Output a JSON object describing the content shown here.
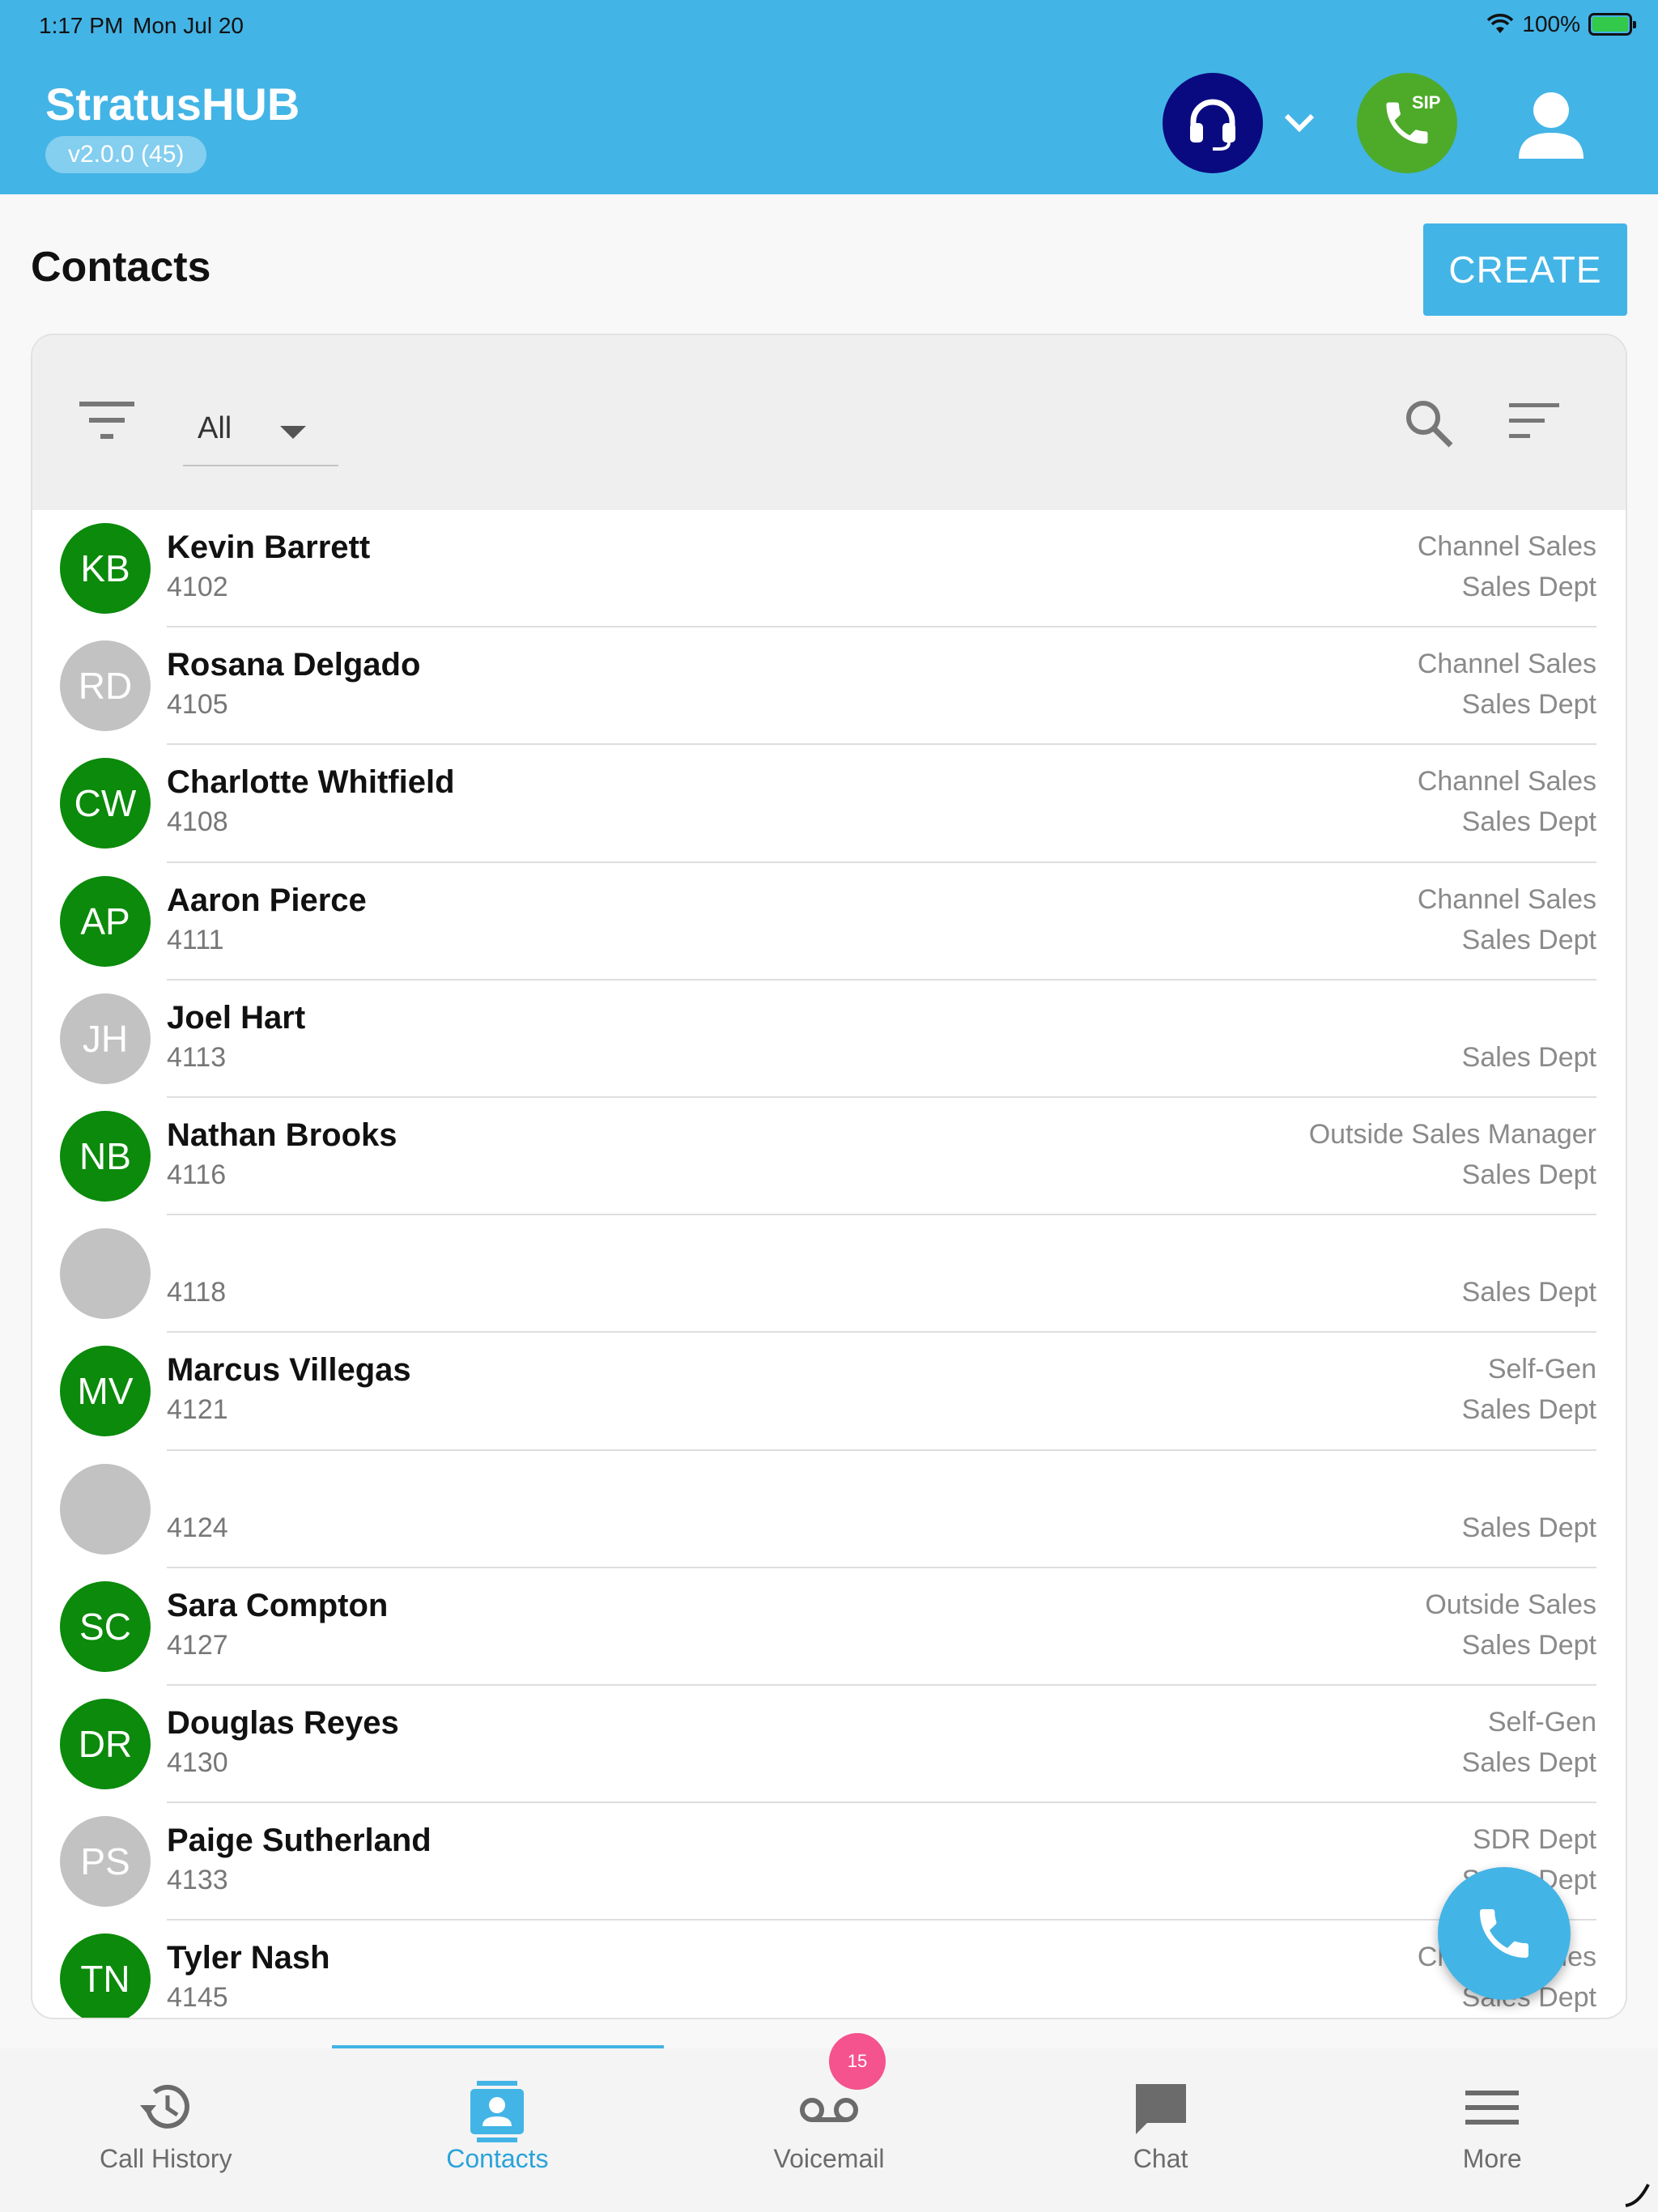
{
  "status_bar": {
    "time": "1:17 PM",
    "date": "Mon Jul 20",
    "battery": "100%"
  },
  "header": {
    "app_title": "StratusHUB",
    "version": "v2.0.0 (45)",
    "sip_label": "SIP",
    "colors": {
      "header_bg": "#43b4e6",
      "queue_btn": "#0a0a80",
      "sip_btn": "#4eaa29"
    }
  },
  "page": {
    "title": "Contacts",
    "create_label": "CREATE"
  },
  "toolbar": {
    "scope_value": "All"
  },
  "contacts": [
    {
      "initials": "KB",
      "name": "Kevin Barrett",
      "ext": "4102",
      "title": "Channel Sales",
      "dept": "Sales Dept",
      "avatar": "green"
    },
    {
      "initials": "RD",
      "name": "Rosana Delgado",
      "ext": "4105",
      "title": "Channel Sales",
      "dept": "Sales Dept",
      "avatar": "gray"
    },
    {
      "initials": "CW",
      "name": "Charlotte Whitfield",
      "ext": "4108",
      "title": "Channel Sales",
      "dept": "Sales Dept",
      "avatar": "green"
    },
    {
      "initials": "AP",
      "name": "Aaron Pierce",
      "ext": "4111",
      "title": "Channel Sales",
      "dept": "Sales Dept",
      "avatar": "green"
    },
    {
      "initials": "JH",
      "name": "Joel Hart",
      "ext": "4113",
      "title": "",
      "dept": "Sales Dept",
      "avatar": "gray"
    },
    {
      "initials": "NB",
      "name": "Nathan Brooks",
      "ext": "4116",
      "title": "Outside Sales Manager",
      "dept": "Sales Dept",
      "avatar": "green"
    },
    {
      "initials": "",
      "name": "",
      "ext": "4118",
      "title": "",
      "dept": "Sales Dept",
      "avatar": "gray"
    },
    {
      "initials": "MV",
      "name": "Marcus Villegas",
      "ext": "4121",
      "title": "Self-Gen",
      "dept": "Sales Dept",
      "avatar": "green"
    },
    {
      "initials": "",
      "name": "",
      "ext": "4124",
      "title": "",
      "dept": "Sales Dept",
      "avatar": "gray"
    },
    {
      "initials": "SC",
      "name": "Sara Compton",
      "ext": "4127",
      "title": "Outside Sales",
      "dept": "Sales Dept",
      "avatar": "green"
    },
    {
      "initials": "DR",
      "name": "Douglas Reyes",
      "ext": "4130",
      "title": "Self-Gen",
      "dept": "Sales Dept",
      "avatar": "green"
    },
    {
      "initials": "PS",
      "name": "Paige Sutherland",
      "ext": "4133",
      "title": "SDR Dept",
      "dept": "Sales Dept",
      "avatar": "gray"
    },
    {
      "initials": "TN",
      "name": "Tyler Nash",
      "ext": "4145",
      "title": "Channel Sales",
      "dept": "Sales Dept",
      "avatar": "green"
    }
  ],
  "bottom_nav": {
    "items": [
      {
        "label": "Call History",
        "icon": "history-icon"
      },
      {
        "label": "Contacts",
        "icon": "contacts-icon"
      },
      {
        "label": "Voicemail",
        "icon": "voicemail-icon"
      },
      {
        "label": "Chat",
        "icon": "chat-icon"
      },
      {
        "label": "More",
        "icon": "menu-icon"
      }
    ],
    "active": "Contacts",
    "voicemail_badge": "15"
  }
}
